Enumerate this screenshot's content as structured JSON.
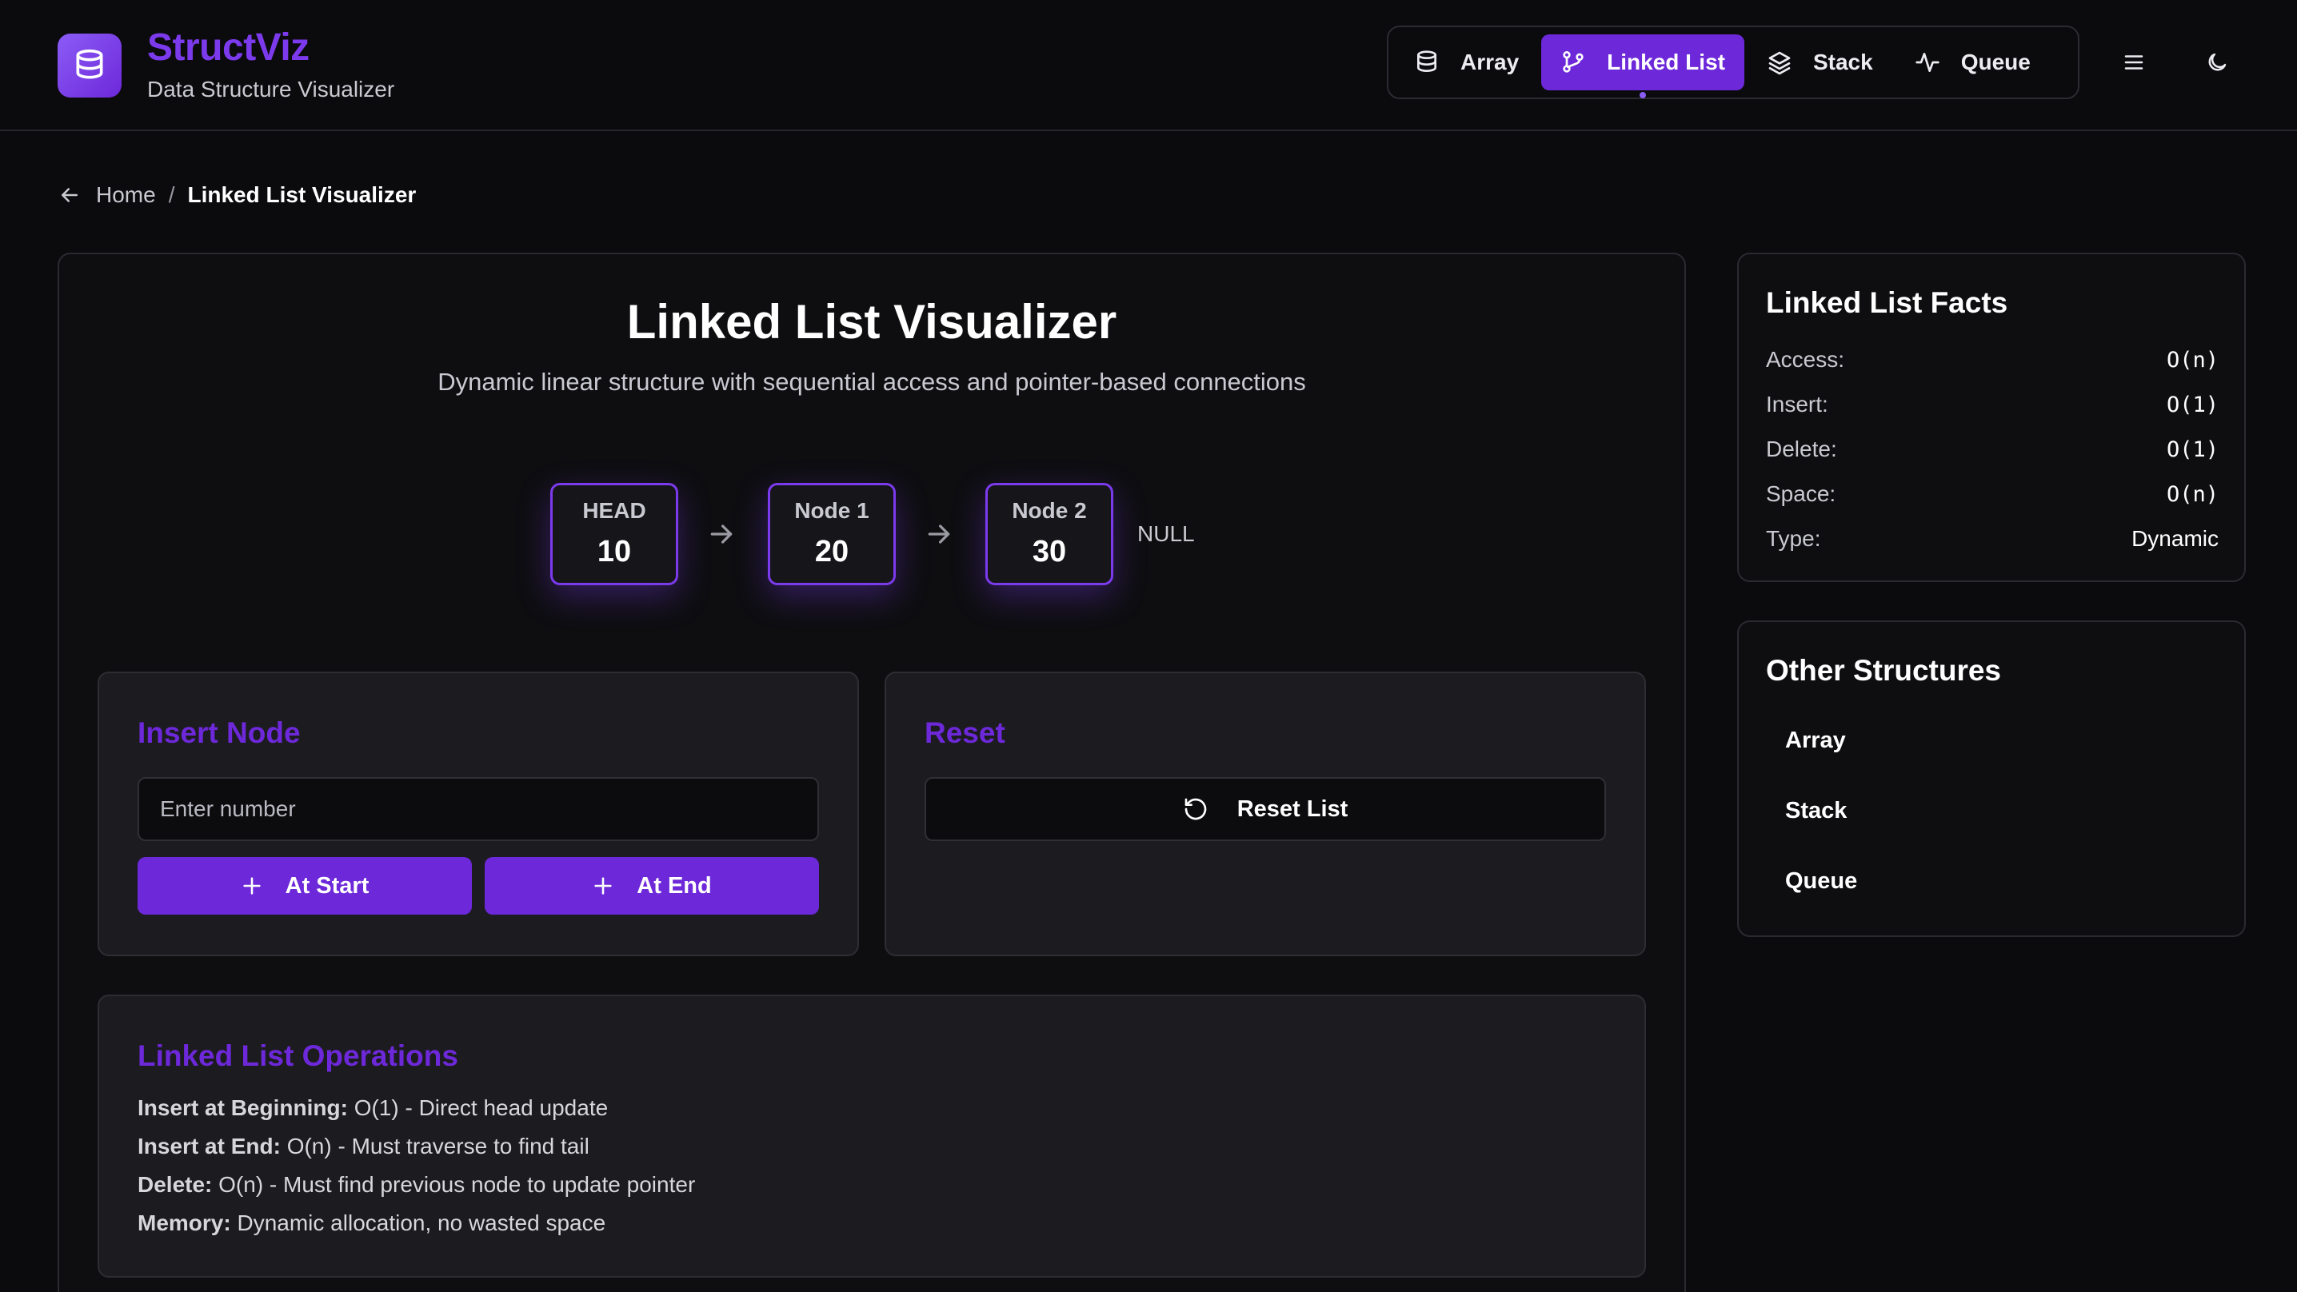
{
  "app": {
    "title": "StructViz",
    "subtitle": "Data Structure Visualizer",
    "logo_icon": "database-icon",
    "accent_color": "#6d28d9"
  },
  "nav": {
    "items": [
      {
        "label": "Array",
        "icon": "database-icon",
        "active": false
      },
      {
        "label": "Linked List",
        "icon": "git-branch-icon",
        "active": true
      },
      {
        "label": "Stack",
        "icon": "layers-icon",
        "active": false
      },
      {
        "label": "Queue",
        "icon": "activity-icon",
        "active": false
      }
    ],
    "menu_icon": "menu-icon",
    "theme_icon": "moon-icon"
  },
  "breadcrumb": {
    "home": "Home",
    "separator": "/",
    "current": "Linked List Visualizer"
  },
  "main": {
    "title": "Linked List Visualizer",
    "subtitle": "Dynamic linear structure with sequential access and pointer-based connections",
    "nodes": [
      {
        "label": "HEAD",
        "value": "10"
      },
      {
        "label": "Node 1",
        "value": "20"
      },
      {
        "label": "Node 2",
        "value": "30"
      }
    ],
    "null_label": "NULL"
  },
  "insert_panel": {
    "title": "Insert Node",
    "input_placeholder": "Enter number",
    "input_value": "",
    "at_start_label": "At Start",
    "at_end_label": "At End"
  },
  "reset_panel": {
    "title": "Reset",
    "button_label": "Reset List"
  },
  "operations": {
    "title": "Linked List Operations",
    "items": [
      {
        "term": "Insert at Beginning:",
        "desc": "O(1) - Direct head update"
      },
      {
        "term": "Insert at End:",
        "desc": "O(n) - Must traverse to find tail"
      },
      {
        "term": "Delete:",
        "desc": "O(n) - Must find previous node to update pointer"
      },
      {
        "term": "Memory:",
        "desc": "Dynamic allocation, no wasted space"
      }
    ]
  },
  "facts": {
    "title": "Linked List Facts",
    "rows": [
      {
        "key": "Access:",
        "value": "O(n)"
      },
      {
        "key": "Insert:",
        "value": "O(1)"
      },
      {
        "key": "Delete:",
        "value": "O(1)"
      },
      {
        "key": "Space:",
        "value": "O(n)"
      },
      {
        "key": "Type:",
        "value": "Dynamic"
      }
    ]
  },
  "other_structures": {
    "title": "Other Structures",
    "items": [
      "Array",
      "Stack",
      "Queue"
    ]
  }
}
